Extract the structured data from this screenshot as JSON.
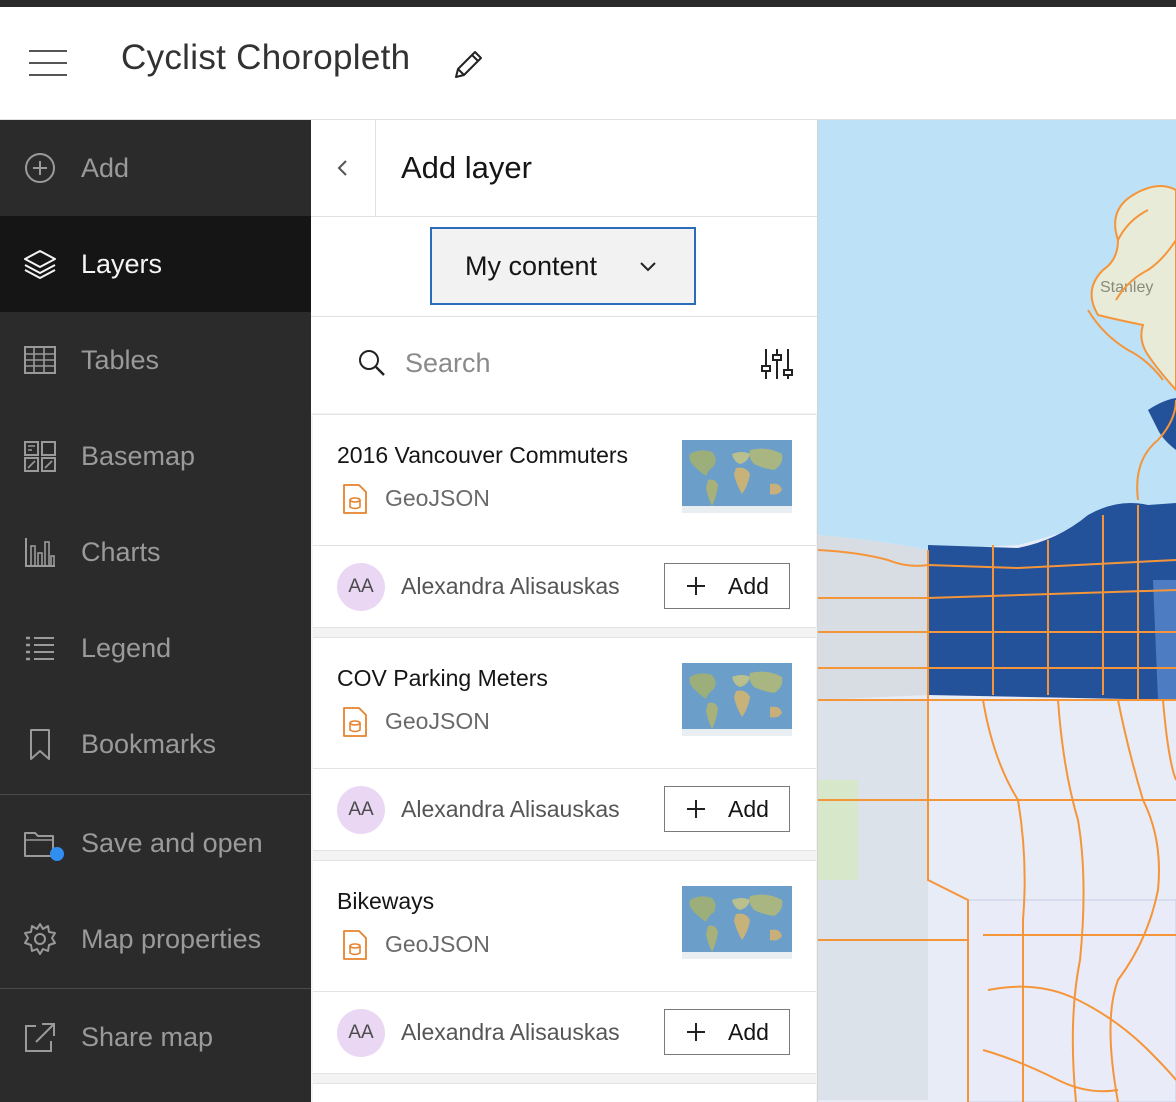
{
  "header": {
    "title": "Cyclist Choropleth"
  },
  "sidebar": {
    "items": [
      {
        "label": "Add",
        "icon": "add-circle-icon"
      },
      {
        "label": "Layers",
        "icon": "layers-icon",
        "active": true
      },
      {
        "label": "Tables",
        "icon": "table-icon"
      },
      {
        "label": "Basemap",
        "icon": "basemap-icon"
      },
      {
        "label": "Charts",
        "icon": "charts-icon"
      },
      {
        "label": "Legend",
        "icon": "legend-icon"
      },
      {
        "label": "Bookmarks",
        "icon": "bookmark-icon"
      },
      {
        "label": "Save and open",
        "icon": "folder-icon",
        "notification": true
      },
      {
        "label": "Map properties",
        "icon": "gear-icon"
      },
      {
        "label": "Share map",
        "icon": "share-icon"
      }
    ]
  },
  "panel": {
    "title": "Add layer",
    "source_dropdown": "My content",
    "search_placeholder": "Search",
    "items": [
      {
        "name": "2016 Vancouver Commuters",
        "type": "GeoJSON",
        "owner_initials": "AA",
        "owner": "Alexandra Alisauskas",
        "add_label": "Add"
      },
      {
        "name": "COV Parking Meters",
        "type": "GeoJSON",
        "owner_initials": "AA",
        "owner": "Alexandra Alisauskas",
        "add_label": "Add"
      },
      {
        "name": "Bikeways",
        "type": "GeoJSON",
        "owner_initials": "AA",
        "owner": "Alexandra Alisauskas",
        "add_label": "Add"
      }
    ]
  },
  "map": {
    "place_label": "Stanley",
    "colors": {
      "water": "#bde2f7",
      "dark_class": "#23529b",
      "light_class": "#d7dff0",
      "route": "#f5953a"
    }
  },
  "colors": {
    "sidebar_bg": "#2b2b2b",
    "sidebar_active": "#151515",
    "accent": "#2b6db8",
    "notification": "#2f8ef0",
    "file_icon": "#e5832f"
  }
}
